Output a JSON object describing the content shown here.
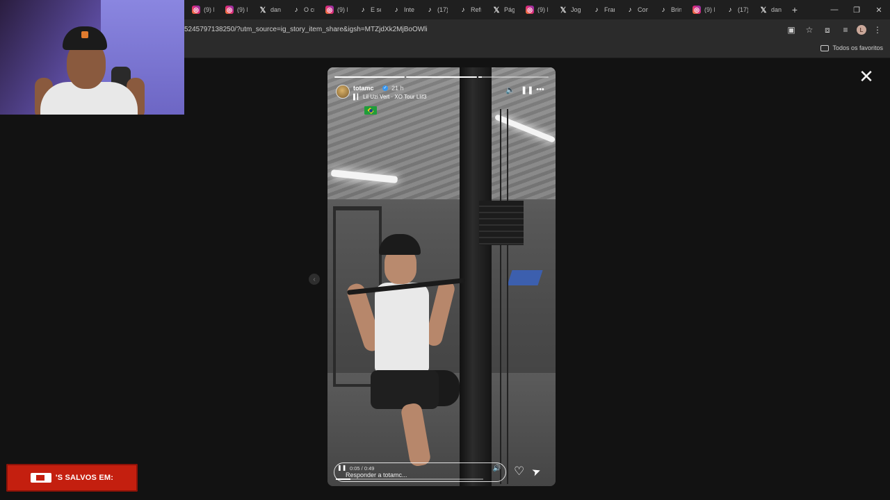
{
  "browser": {
    "tabs": [
      {
        "icon": "instagram-icon",
        "label": "(9) I"
      },
      {
        "icon": "instagram-icon",
        "label": "(9) I"
      },
      {
        "icon": "x-icon",
        "label": "danc"
      },
      {
        "icon": "tiktok-icon",
        "label": "O cri"
      },
      {
        "icon": "instagram-icon",
        "label": "(9) I"
      },
      {
        "icon": "tiktok-icon",
        "label": "E se"
      },
      {
        "icon": "tiktok-icon",
        "label": "Inter"
      },
      {
        "icon": "tiktok-icon",
        "label": "(17)"
      },
      {
        "icon": "tiktok-icon",
        "label": "Refr"
      },
      {
        "icon": "x-icon",
        "label": "Pági"
      },
      {
        "icon": "instagram-icon",
        "label": "(9) I"
      },
      {
        "icon": "x-icon",
        "label": "Jogu"
      },
      {
        "icon": "tiktok-icon",
        "label": "Fran"
      },
      {
        "icon": "tiktok-icon",
        "label": "Com"
      },
      {
        "icon": "tiktok-icon",
        "label": "Brin"
      },
      {
        "icon": "instagram-icon",
        "label": "(9) I"
      },
      {
        "icon": "tiktok-icon",
        "label": "(17)"
      },
      {
        "icon": "x-icon",
        "label": "danc"
      }
    ],
    "new_tab": "+",
    "url": "5245797138250/?utm_source=ig_story_item_share&igsh=MTZjdXk2MjBoOWli",
    "profile_initial": "L",
    "bookmarks_label": "Todos os favoritos"
  },
  "story": {
    "username": "totamc",
    "time": "21 h",
    "music": "Lil Uzi Vert · XO Tour Llif3",
    "progress": [
      1,
      1,
      0.05
    ],
    "video_time": "0:05 / 0:49",
    "video_progress": 0.1,
    "reply_placeholder": "Responder a totamc...",
    "colors": {
      "verified": "#3897f0",
      "flag_green": "#1f9d3a",
      "flag_yellow": "#f6d313"
    }
  },
  "overlay": {
    "saved_text": "'S SALVOS EM:",
    "banner_color": "#c41f0f"
  }
}
